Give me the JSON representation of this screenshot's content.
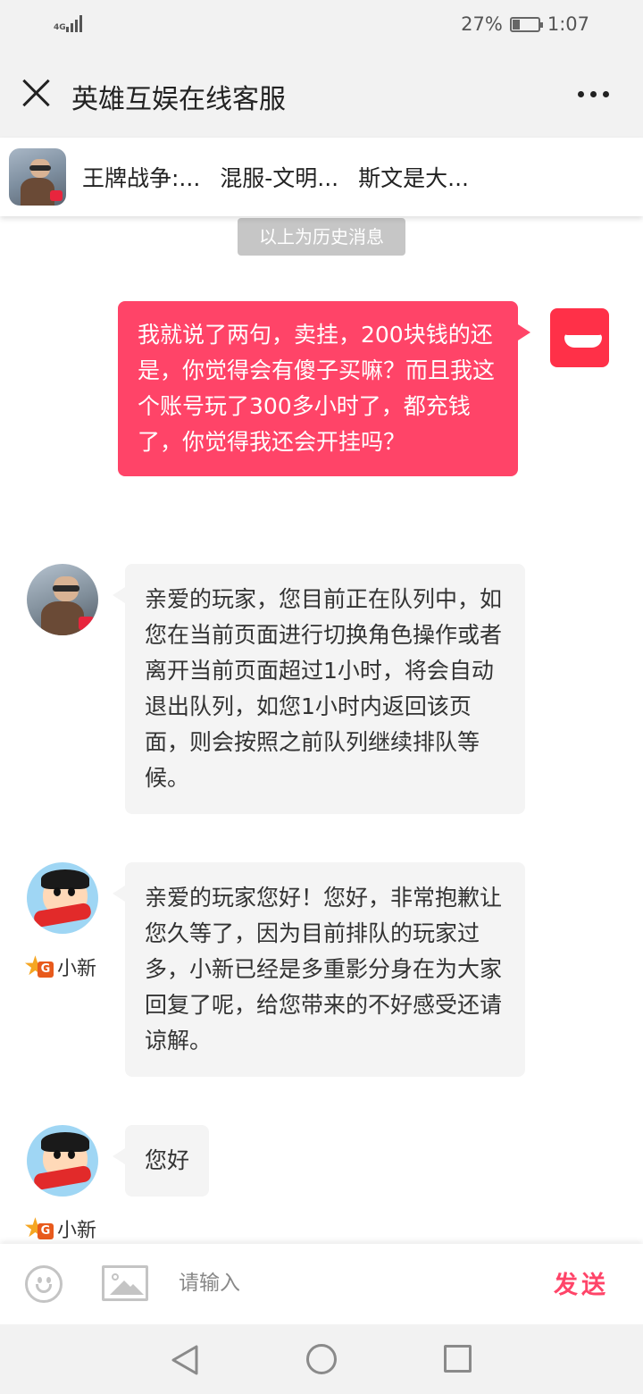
{
  "status_bar": {
    "network": "4G",
    "battery_percent": "27%",
    "battery_level": 0.27,
    "time": "1:07"
  },
  "header": {
    "title": "英雄互娱在线客服",
    "close_icon": "close-icon",
    "more_icon": "more-icon"
  },
  "game_bar": {
    "items": [
      "王牌战争:...",
      "混服-文明...",
      "斯文是大..."
    ]
  },
  "chat": {
    "history_label": "以上为历史消息",
    "messages": [
      {
        "from": "me",
        "text": "我就说了两句，卖挂，200块钱的还是，你觉得会有傻子买嘛？而且我这个账号玩了300多小时了，都充钱了，你觉得我还会开挂吗？"
      },
      {
        "from": "system",
        "text": "亲爱的玩家，您目前正在队列中，如您在当前页面进行切换角色操作或者离开当前页面超过1小时，将会自动退出队列，如您1小时内返回该页面，则会按照之前队列继续排队等候。"
      },
      {
        "from": "agent",
        "name": "小新",
        "level_badge": "G",
        "text": "亲爱的玩家您好！您好，非常抱歉让您久等了，因为目前排队的玩家过多，小新已经是多重影分身在为大家回复了呢，给您带来的不好感受还请谅解。"
      },
      {
        "from": "agent",
        "name": "小新",
        "level_badge": "G",
        "text": "您好"
      }
    ]
  },
  "input_bar": {
    "placeholder": "请输入",
    "value": "",
    "send_label": "发送",
    "emoji_icon": "emoji-icon",
    "image_icon": "image-icon"
  },
  "nav_bar": {
    "back_icon": "back-triangle-icon",
    "home_icon": "home-circle-icon",
    "recent_icon": "recent-square-icon"
  },
  "colors": {
    "accent": "#ff4468",
    "bubble_in": "#f4f4f4",
    "header_bg": "#f2f2f2"
  }
}
